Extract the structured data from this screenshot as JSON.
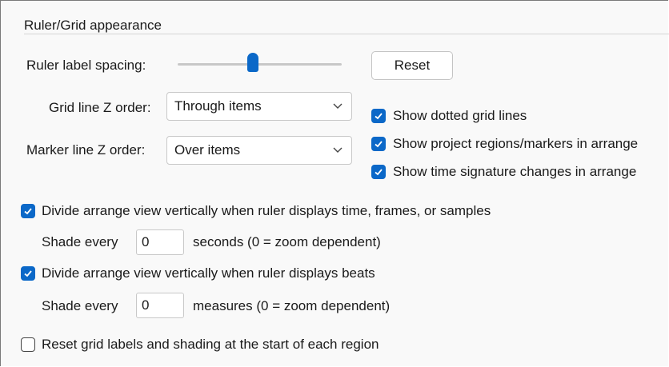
{
  "group": {
    "title": "Ruler/Grid appearance"
  },
  "ruler": {
    "label": "Ruler label spacing:",
    "slider_level": 0.46,
    "reset_label": "Reset"
  },
  "grid_z": {
    "label": "Grid line Z order:",
    "value": "Through items"
  },
  "marker_z": {
    "label": "Marker line Z order:",
    "value": "Over items"
  },
  "checks": {
    "dotted": {
      "label": "Show dotted grid lines",
      "checked": true
    },
    "regions": {
      "label": "Show project regions/markers in arrange",
      "checked": true
    },
    "timesig": {
      "label": "Show time signature changes in arrange",
      "checked": true
    },
    "divide_time": {
      "label": "Divide arrange view vertically when ruler displays time, frames, or samples",
      "checked": true
    },
    "divide_beats": {
      "label": "Divide arrange view vertically when ruler displays beats",
      "checked": true
    },
    "reset_grid": {
      "label": "Reset grid labels and shading at the start of each region",
      "checked": false
    }
  },
  "shade_time": {
    "prefix": "Shade every",
    "value": "0",
    "suffix": "seconds (0 = zoom dependent)"
  },
  "shade_beats": {
    "prefix": "Shade every",
    "value": "0",
    "suffix": "measures (0 = zoom dependent)"
  },
  "colors": {
    "accent": "#0b68c8",
    "panel": "#f9f9f9"
  },
  "icons": {
    "chevron": "chevron-down-icon",
    "check": "check-icon"
  }
}
